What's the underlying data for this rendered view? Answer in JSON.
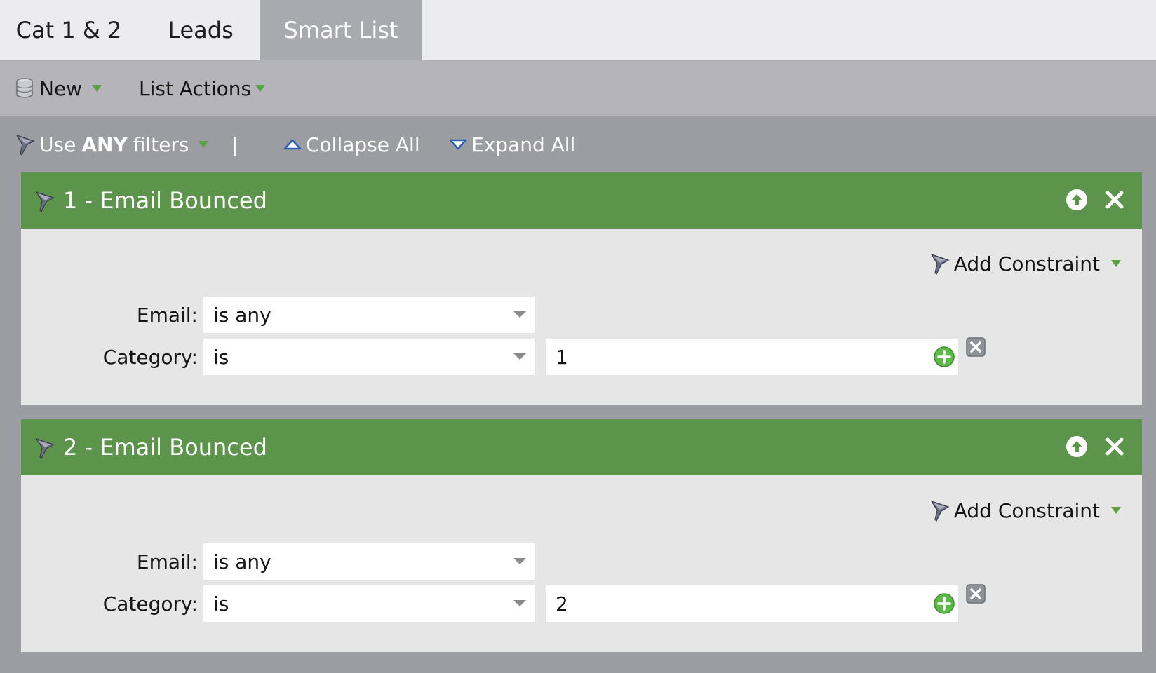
{
  "tabs": [
    {
      "label": "Cat 1 & 2",
      "active": false
    },
    {
      "label": "Leads",
      "active": false
    },
    {
      "label": "Smart List",
      "active": true
    }
  ],
  "toolbar": {
    "new_label": "New",
    "list_actions_label": "List Actions"
  },
  "filterbar": {
    "use_prefix": "Use",
    "use_bold": "ANY",
    "use_suffix": "filters",
    "separator": "|",
    "collapse_all": "Collapse All",
    "expand_all": "Expand All"
  },
  "filters": [
    {
      "title": "1 - Email Bounced",
      "add_constraint": "Add Constraint",
      "rows": [
        {
          "label": "Email:",
          "operator": "is any"
        },
        {
          "label": "Category:",
          "operator": "is",
          "value": "1"
        }
      ]
    },
    {
      "title": "2 - Email Bounced",
      "add_constraint": "Add Constraint",
      "rows": [
        {
          "label": "Email:",
          "operator": "is any"
        },
        {
          "label": "Category:",
          "operator": "is",
          "value": "2"
        }
      ]
    }
  ],
  "colors": {
    "panel_header": "#5c944c",
    "panel_body": "#e6e6e6",
    "page_bg": "#9c9ca3",
    "accent_green": "#55a53b"
  }
}
